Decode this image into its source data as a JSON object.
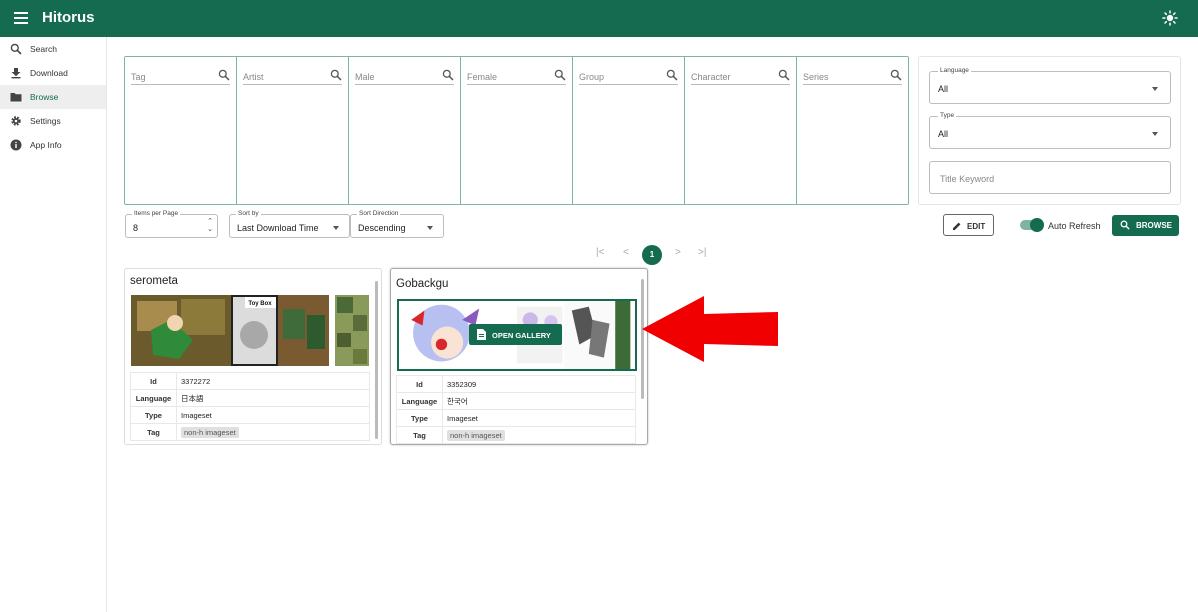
{
  "app": {
    "title": "Hitorus"
  },
  "sidebar": {
    "items": [
      {
        "label": "Search",
        "icon": "search-icon"
      },
      {
        "label": "Download",
        "icon": "download-icon"
      },
      {
        "label": "Browse",
        "icon": "folder-icon",
        "active": true
      },
      {
        "label": "Settings",
        "icon": "gear-icon"
      },
      {
        "label": "App Info",
        "icon": "info-icon"
      }
    ]
  },
  "tag_filters": {
    "columns": [
      "Tag",
      "Artist",
      "Male",
      "Female",
      "Group",
      "Character",
      "Series"
    ]
  },
  "filters": {
    "language": {
      "label": "Language",
      "value": "All"
    },
    "type": {
      "label": "Type",
      "value": "All"
    },
    "title_keyword": {
      "placeholder": "Title Keyword"
    }
  },
  "controls": {
    "items_per_page": {
      "label": "Items per Page",
      "value": "8"
    },
    "sort_by": {
      "label": "Sort by",
      "value": "Last Download Time"
    },
    "sort_direction": {
      "label": "Sort Direction",
      "value": "Descending"
    },
    "edit_label": "EDIT",
    "auto_refresh_label": "Auto Refresh",
    "auto_refresh_on": true,
    "browse_label": "BROWSE"
  },
  "pagination": {
    "current_page": "1",
    "first": "|<",
    "prev": "<",
    "next": ">",
    "last": ">|"
  },
  "gallery_cards": [
    {
      "title": "serometa",
      "thumb_caption": "Toy Box",
      "rows": [
        {
          "key": "Id",
          "value": "3372272"
        },
        {
          "key": "Language",
          "value": "日本語"
        },
        {
          "key": "Type",
          "value": "Imageset"
        },
        {
          "key": "Tag",
          "value": "non-h imageset"
        }
      ]
    },
    {
      "title": "Gobackgu",
      "open_gallery_label": "OPEN GALLERY",
      "rows": [
        {
          "key": "Id",
          "value": "3352309"
        },
        {
          "key": "Language",
          "value": "한국어"
        },
        {
          "key": "Type",
          "value": "Imageset"
        },
        {
          "key": "Tag",
          "value": "non-h imageset"
        }
      ]
    }
  ],
  "colors": {
    "brand": "#146b4f",
    "arrow": "#f00000"
  }
}
